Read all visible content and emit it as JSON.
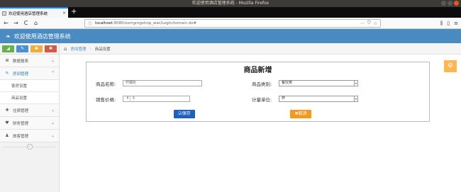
{
  "os": {
    "window_title": "欢迎使用酒店管理系统 - Mozilla Firefox"
  },
  "browser": {
    "tab_title": "欢迎使用酒店管理系统",
    "tab_close": "×",
    "new_tab": "+",
    "url_host": "localhost",
    "url_path": ":8080/ssmgrogshop_war/Login/tomain.do#",
    "nav_back": "←",
    "nav_forward": "→",
    "nav_reload": "C",
    "nav_home": "⌂",
    "url_more": "···",
    "url_shield": "⛉",
    "url_star": "☆"
  },
  "app": {
    "title": "欢迎使用酒店管理系统"
  },
  "sidebar": {
    "items": [
      {
        "label": "数据报表",
        "icon": "⊞"
      },
      {
        "label": "房间管理",
        "icon": "✎",
        "active": true
      },
      {
        "label": "住宿管理",
        "icon": "✚"
      },
      {
        "label": "财务管理",
        "icon": "♥"
      },
      {
        "label": "旅客管理",
        "icon": "♟"
      }
    ],
    "subitems": [
      "客房设置",
      "商品设置"
    ]
  },
  "breadcrumb": {
    "link": "房间管理",
    "current": "商品设置"
  },
  "form": {
    "title": "商品新增",
    "name_label": "商品名称:",
    "name_value": "柠檬奶",
    "category_label": "商品类别:",
    "category_value": "餐饮类",
    "price_label": "销售价格:",
    "price_prefix": "¥",
    "price_value": "5",
    "unit_label": "计量单位:",
    "unit_value": "杯",
    "save_label": "保存",
    "cancel_label": "取消"
  }
}
